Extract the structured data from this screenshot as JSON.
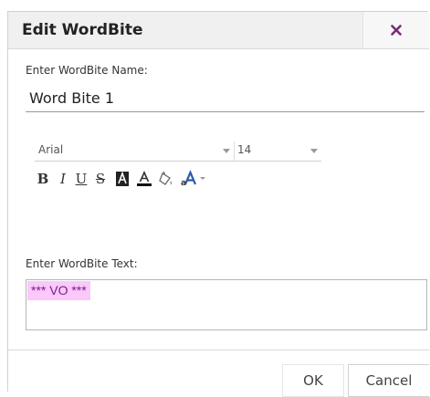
{
  "dialog": {
    "title": "Edit WordBite",
    "close_icon": "close-icon",
    "accent_color": "#7a2a7a"
  },
  "name_field": {
    "label": "Enter WordBite Name:",
    "value": "Word Bite 1"
  },
  "toolbar": {
    "font_family": "Arial",
    "font_size": "14",
    "bold_label": "B",
    "italic_label": "I",
    "underline_label": "U",
    "strike_label": "S",
    "tools": [
      "bold-icon",
      "italic-icon",
      "underline-icon",
      "strikethrough-icon",
      "background-color-icon",
      "font-color-icon",
      "clear-formatting-icon",
      "text-effects-icon"
    ]
  },
  "text_field": {
    "label": "Enter WordBite Text:",
    "value": "*** VO ***",
    "highlight_color": "#fac8fa"
  },
  "footer": {
    "ok_label": "OK",
    "cancel_label": "Cancel"
  }
}
